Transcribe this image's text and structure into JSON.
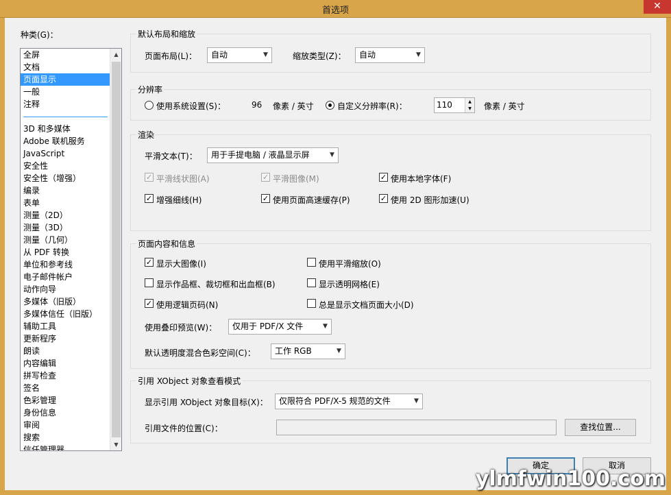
{
  "window": {
    "title": "首选项",
    "close_icon": "✕"
  },
  "categories": {
    "label": "种类(G)：",
    "group1": [
      "全屏",
      "文档",
      "页面显示",
      "一般",
      "注释"
    ],
    "selected_index": 2,
    "group2": [
      "3D 和多媒体",
      "Adobe 联机服务",
      "JavaScript",
      "安全性",
      "安全性（增强）",
      "编录",
      "表单",
      "测量（2D）",
      "测量（3D）",
      "测量（几何）",
      "从 PDF 转换",
      "单位和参考线",
      "电子邮件帐户",
      "动作向导",
      "多媒体（旧版）",
      "多媒体信任（旧版）",
      "辅助工具",
      "更新程序",
      "朗读",
      "内容编辑",
      "拼写检查",
      "签名",
      "色彩管理",
      "身份信息",
      "审阅",
      "搜索",
      "信任管理器"
    ]
  },
  "layout_group": {
    "title": "默认布局和缩放",
    "page_layout_label": "页面布局(L)：",
    "page_layout_value": "自动",
    "zoom_type_label": "缩放类型(Z)：",
    "zoom_type_value": "自动"
  },
  "resolution_group": {
    "title": "分辨率",
    "system_label": "使用系统设置(S)：",
    "system_value": "96",
    "system_unit": "像素 / 英寸",
    "custom_label": "自定义分辨率(R)：",
    "custom_value": "110",
    "custom_unit": "像素 / 英寸",
    "selected": "custom"
  },
  "render_group": {
    "title": "渲染",
    "smooth_text_label": "平滑文本(T)：",
    "smooth_text_value": "用于手提电脑 / 液晶显示屏",
    "smooth_lines": {
      "label": "平滑线状图(A)",
      "checked": true,
      "disabled": true
    },
    "smooth_images": {
      "label": "平滑图像(M)",
      "checked": true,
      "disabled": true
    },
    "local_fonts": {
      "label": "使用本地字体(F)",
      "checked": true
    },
    "enhance_thin": {
      "label": "增强细线(H)",
      "checked": true
    },
    "page_cache": {
      "label": "使用页面高速缓存(P)",
      "checked": true
    },
    "gpu_2d": {
      "label": "使用 2D 图形加速(U)",
      "checked": true
    }
  },
  "content_group": {
    "title": "页面内容和信息",
    "large_images": {
      "label": "显示大图像(I)",
      "checked": true
    },
    "smooth_zoom": {
      "label": "使用平滑缩放(O)",
      "checked": false
    },
    "art_boxes": {
      "label": "显示作品框、裁切框和出血框(B)",
      "checked": false
    },
    "transparency_grid": {
      "label": "显示透明网格(E)",
      "checked": false
    },
    "logical_page_numbers": {
      "label": "使用逻辑页码(N)",
      "checked": true
    },
    "doc_page_size": {
      "label": "总是显示文档页面大小(D)",
      "checked": false
    },
    "overprint_label": "使用叠印预览(W)：",
    "overprint_value": "仅用于 PDF/X 文件",
    "blend_label": "默认透明度混合色彩空间(C)：",
    "blend_value": "工作 RGB"
  },
  "xobject_group": {
    "title": "引用 XObject 对象查看模式",
    "target_label": "显示引用 XObject 对象目标(X)：",
    "target_value": "仅限符合 PDF/X-5 规范的文件",
    "location_label": "引用文件的位置(C)：",
    "location_value": "",
    "browse_button": "查找位置..."
  },
  "footer": {
    "ok_button": "确定",
    "cancel_button": "取消"
  },
  "watermark": "ylmfwin100.com",
  "check_mark": "✓"
}
